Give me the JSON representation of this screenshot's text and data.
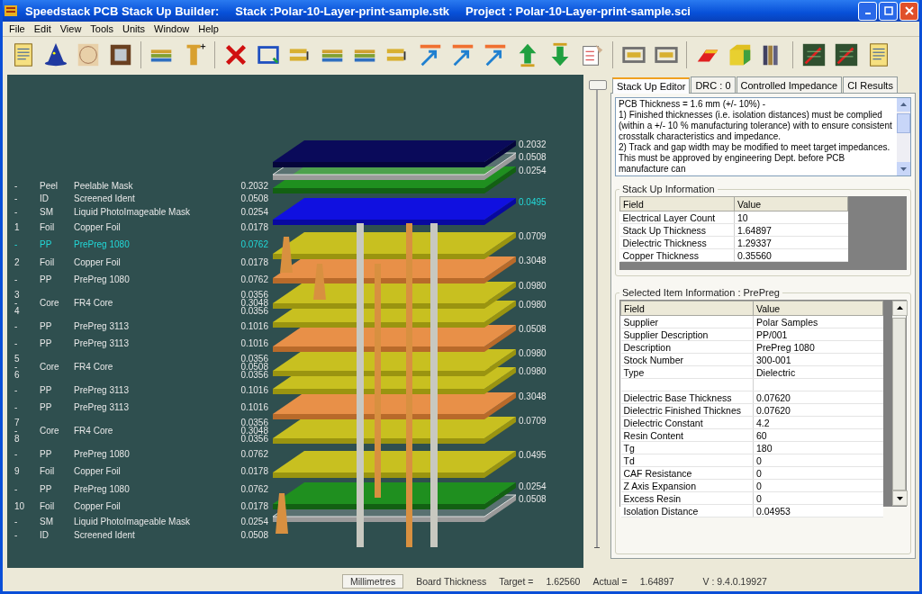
{
  "window": {
    "title_app": "Speedstack PCB Stack Up Builder:",
    "title_stack": "Stack :Polar-10-Layer-print-sample.stk",
    "title_project": "Project : Polar-10-Layer-print-sample.sci"
  },
  "menu": [
    "File",
    "Edit",
    "View",
    "Tools",
    "Units",
    "Window",
    "Help"
  ],
  "stack_list": [
    {
      "kind": "single",
      "num": "-",
      "code": "Peel",
      "name": "Peelable Mask",
      "thickness": "0.2032",
      "selected": false
    },
    {
      "kind": "single",
      "num": "-",
      "code": "ID",
      "name": "Screened Ident",
      "thickness": "0.0508",
      "selected": false
    },
    {
      "kind": "single",
      "num": "-",
      "code": "SM",
      "name": "Liquid PhotoImageable Mask",
      "thickness": "0.0254",
      "selected": false
    },
    {
      "kind": "single",
      "num": "1",
      "code": "Foil",
      "name": "Copper Foil",
      "thickness": "0.0178",
      "selected": false
    },
    {
      "kind": "single",
      "num": "-",
      "code": "PP",
      "name": "PrePreg 1080",
      "thickness": "0.0762",
      "selected": true
    },
    {
      "kind": "single",
      "num": "2",
      "code": "Foil",
      "name": "Copper Foil",
      "thickness": "0.0178",
      "selected": false
    },
    {
      "kind": "single",
      "num": "-",
      "code": "PP",
      "name": "PrePreg 1080",
      "thickness": "0.0762",
      "selected": false
    },
    {
      "kind": "core",
      "nums": [
        "3",
        "-",
        "4"
      ],
      "code": "Core",
      "name": "FR4 Core",
      "thicknesses": [
        "0.0356",
        "0.3048",
        "0.0356"
      ],
      "selected": false
    },
    {
      "kind": "single",
      "num": "-",
      "code": "PP",
      "name": "PrePreg 3113",
      "thickness": "0.1016",
      "selected": false
    },
    {
      "kind": "single",
      "num": "-",
      "code": "PP",
      "name": "PrePreg 3113",
      "thickness": "0.1016",
      "selected": false
    },
    {
      "kind": "core",
      "nums": [
        "5",
        "-",
        "6"
      ],
      "code": "Core",
      "name": "FR4 Core",
      "thicknesses": [
        "0.0356",
        "0.0508",
        "0.0356"
      ],
      "selected": false
    },
    {
      "kind": "single",
      "num": "-",
      "code": "PP",
      "name": "PrePreg 3113",
      "thickness": "0.1016",
      "selected": false
    },
    {
      "kind": "single",
      "num": "-",
      "code": "PP",
      "name": "PrePreg 3113",
      "thickness": "0.1016",
      "selected": false
    },
    {
      "kind": "core",
      "nums": [
        "7",
        "-",
        "8"
      ],
      "code": "Core",
      "name": "FR4 Core",
      "thicknesses": [
        "0.0356",
        "0.3048",
        "0.0356"
      ],
      "selected": false
    },
    {
      "kind": "single",
      "num": "-",
      "code": "PP",
      "name": "PrePreg 1080",
      "thickness": "0.0762",
      "selected": false
    },
    {
      "kind": "single",
      "num": "9",
      "code": "Foil",
      "name": "Copper Foil",
      "thickness": "0.0178",
      "selected": false
    },
    {
      "kind": "single",
      "num": "-",
      "code": "PP",
      "name": "PrePreg 1080",
      "thickness": "0.0762",
      "selected": false
    },
    {
      "kind": "single",
      "num": "10",
      "code": "Foil",
      "name": "Copper Foil",
      "thickness": "0.0178",
      "selected": false
    },
    {
      "kind": "single",
      "num": "-",
      "code": "SM",
      "name": "Liquid PhotoImageable Mask",
      "thickness": "0.0254",
      "selected": false
    },
    {
      "kind": "single",
      "num": "-",
      "code": "ID",
      "name": "Screened Ident",
      "thickness": "0.0508",
      "selected": false
    }
  ],
  "drawing_labels": [
    {
      "text": "0.2032",
      "kind": "peel",
      "selected": false
    },
    {
      "text": "0.0508",
      "kind": "ident",
      "selected": false
    },
    {
      "text": "0.0254",
      "kind": "mask",
      "selected": false
    },
    {
      "text": "0.0495",
      "kind": "prepreg",
      "selected": true
    },
    {
      "text": "0.0709",
      "kind": "prepreg",
      "selected": false
    },
    {
      "text": "0.3048",
      "kind": "core",
      "selected": false
    },
    {
      "text": "0.0980",
      "kind": "prepreg",
      "selected": false
    },
    {
      "text": "0.0980",
      "kind": "prepreg",
      "selected": false
    },
    {
      "text": "0.0508",
      "kind": "core",
      "selected": false
    },
    {
      "text": "0.0980",
      "kind": "prepreg",
      "selected": false
    },
    {
      "text": "0.0980",
      "kind": "prepreg",
      "selected": false
    },
    {
      "text": "0.3048",
      "kind": "core",
      "selected": false
    },
    {
      "text": "0.0709",
      "kind": "prepreg",
      "selected": false
    },
    {
      "text": "0.0495",
      "kind": "prepreg",
      "selected": false
    },
    {
      "text": "0.0254",
      "kind": "mask",
      "selected": false
    },
    {
      "text": "0.0508",
      "kind": "ident",
      "selected": false
    }
  ],
  "view_slider": {
    "level": 1
  },
  "tabs": [
    {
      "label": "Stack Up Editor",
      "selected": true
    },
    {
      "label": "DRC : 0",
      "selected": false
    },
    {
      "label": "Controlled Impedance",
      "selected": false
    },
    {
      "label": "CI Results",
      "selected": false
    }
  ],
  "notes": [
    "PCB Thickness = 1.6 mm (+/- 10%)  -",
    "1) Finished thicknesses (i.e. isolation distances) must be complied (within a +/- 10 % manufacturing tolerance) with to ensure consistent crosstalk characteristics and impedance.",
    "2) Track and gap width may be modified to meet target impedances. This must be approved by engineering Dept. before PCB manufacture can"
  ],
  "stack_info": {
    "title": "Stack Up Information",
    "columns": [
      "Field",
      "Value"
    ],
    "rows": [
      [
        "Electrical Layer Count",
        "10"
      ],
      [
        "Stack Up Thickness",
        "1.64897"
      ],
      [
        "Dielectric Thickness",
        "1.29337"
      ],
      [
        "Copper Thickness",
        "0.35560"
      ]
    ]
  },
  "item_info": {
    "title": "Selected Item Information : PrePreg",
    "columns": [
      "Field",
      "Value"
    ],
    "rows": [
      [
        "Supplier",
        "Polar Samples"
      ],
      [
        "Supplier Description",
        "PP/001"
      ],
      [
        "Description",
        "PrePreg 1080"
      ],
      [
        "Stock Number",
        "300-001"
      ],
      [
        "Type",
        "Dielectric"
      ],
      [
        "",
        ""
      ],
      [
        "Dielectric Base Thickness",
        "0.07620"
      ],
      [
        "Dielectric Finished Thicknes",
        "0.07620"
      ],
      [
        "Dielectric Constant",
        "4.2"
      ],
      [
        "Resin Content",
        "60"
      ],
      [
        "Tg",
        "180"
      ],
      [
        "Td",
        "0"
      ],
      [
        "CAF Resistance",
        "0"
      ],
      [
        "Z Axis Expansion",
        "0"
      ],
      [
        "Excess Resin",
        "0"
      ],
      [
        "Isolation Distance",
        "0.04953"
      ]
    ]
  },
  "status_bar": {
    "units": "Millimetres",
    "mode": "Board Thickness",
    "target_label": "Target =",
    "target": "1.62560",
    "actual_label": "Actual =",
    "actual": "1.64897",
    "version": "V : 9.4.0.19927"
  }
}
